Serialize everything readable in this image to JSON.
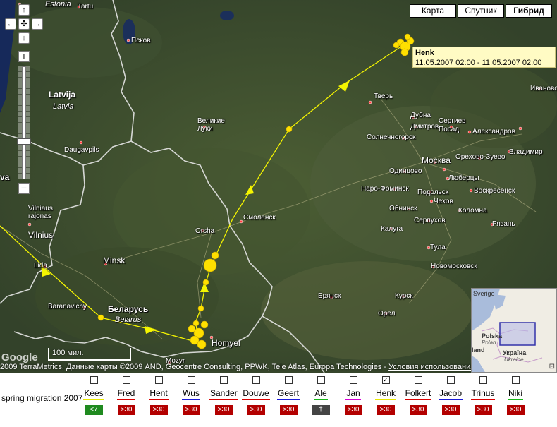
{
  "map": {
    "type_buttons": [
      {
        "id": "map",
        "label": "Карта"
      },
      {
        "id": "satellite",
        "label": "Спутник"
      },
      {
        "id": "hybrid",
        "label": "Гибрид",
        "active": true
      }
    ],
    "zoom_in": "+",
    "zoom_out": "−",
    "places": {
      "estonia": "Estonia",
      "tartu": "Tartu",
      "pskov": "Псков",
      "latvija": "Latvija",
      "latvia": "Latvia",
      "daugavpils": "Daugavpils",
      "velikie_luki": "Великие\nЛуки",
      "vilniaus": "Vilniaus\nrajonas",
      "vilnius": "Vilnius",
      "lida": "Lida",
      "minsk": "Minsk",
      "orsha": "Orsha",
      "smolensk": "Смоленск",
      "baranavichy": "Baranavichy",
      "belarus_ru": "Беларусь",
      "belarus": "Belarus",
      "homyel": "Homyel",
      "mozyr": "Mozyr",
      "tver": "Тверь",
      "dubna": "Дубна",
      "dmitrov": "Дмитров",
      "sergiev": "Сергиев\nПосад",
      "aleksandrov": "Александров",
      "ivanovo": "Иваново",
      "vladimir": "Владимир",
      "solnechnogorsk": "Солнечногорск",
      "moskva": "Москва",
      "orekhovo": "Орехово-Зуево",
      "odintsovo": "Одинцово",
      "lyubertsy": "Люберцы",
      "naro": "Наро-Фоминск",
      "podolsk": "Подольск",
      "voskresensk": "Воскресенск",
      "obninsk": "Обнинск",
      "chekhov": "Чехов",
      "kolomna": "Коломна",
      "serpukhov": "Серпухов",
      "ryazan": "Рязань",
      "kaluga": "Калуга",
      "tula": "Тула",
      "novomoskovsk": "Новомосковск",
      "bryansk": "Брянск",
      "orel": "Орел",
      "kursk": "Курск",
      "va": "va"
    },
    "marker_label": {
      "name": "Henk",
      "time": "11.05.2007 02:00 - 11.05.2007 02:00"
    },
    "overview": {
      "sverige": "Sverige",
      "polska": "Polska",
      "poland": "Polan",
      "ukraina": "Україна",
      "ukraine": "Ukraine",
      "land": "land"
    },
    "scale_label": "100 мил.",
    "copyright": "2009 TerraMetrics, Данные карты ©2009 AND, Geocentre Consulting, PPWK, Tele Atlas, Europa Technologies - ",
    "terms_link": "Условия использования",
    "google": "Google"
  },
  "legend": {
    "title": "spring migration 2007",
    "birds": [
      {
        "name": "Kees",
        "color": "#e8e800",
        "badge": "<7",
        "badge_color": "#1f8a1f",
        "checked": false
      },
      {
        "name": "Fred",
        "color": "#d90000",
        "badge": ">30",
        "badge_color": "#b30000",
        "checked": false
      },
      {
        "name": "Hent",
        "color": "#d90000",
        "badge": ">30",
        "badge_color": "#b30000",
        "checked": false
      },
      {
        "name": "Wus",
        "color": "#1a1ad9",
        "badge": ">30",
        "badge_color": "#b30000",
        "checked": false
      },
      {
        "name": "Sander",
        "color": "#d90000",
        "badge": ">30",
        "badge_color": "#b30000",
        "checked": false
      },
      {
        "name": "Douwe",
        "color": "#d90000",
        "badge": ">30",
        "badge_color": "#b30000",
        "checked": false
      },
      {
        "name": "Geert",
        "color": "#1a1ad9",
        "badge": ">30",
        "badge_color": "#b30000",
        "checked": false
      },
      {
        "name": "Ale",
        "color": "#1ab81a",
        "badge": "†",
        "badge_color": "#444444",
        "checked": false
      },
      {
        "name": "Jan",
        "color": "#d400d4",
        "badge": ">30",
        "badge_color": "#b30000",
        "checked": false
      },
      {
        "name": "Henk",
        "color": "#e8e800",
        "badge": ">30",
        "badge_color": "#b30000",
        "checked": true
      },
      {
        "name": "Folkert",
        "color": "#d90000",
        "badge": ">30",
        "badge_color": "#b30000",
        "checked": false
      },
      {
        "name": "Jacob",
        "color": "#1a1ad9",
        "badge": ">30",
        "badge_color": "#b30000",
        "checked": false
      },
      {
        "name": "Trinus",
        "color": "#d90000",
        "badge": ">30",
        "badge_color": "#b30000",
        "checked": false
      },
      {
        "name": "Niki",
        "color": "#1ab81a",
        "badge": ">30",
        "badge_color": "#b30000",
        "checked": false
      }
    ]
  }
}
